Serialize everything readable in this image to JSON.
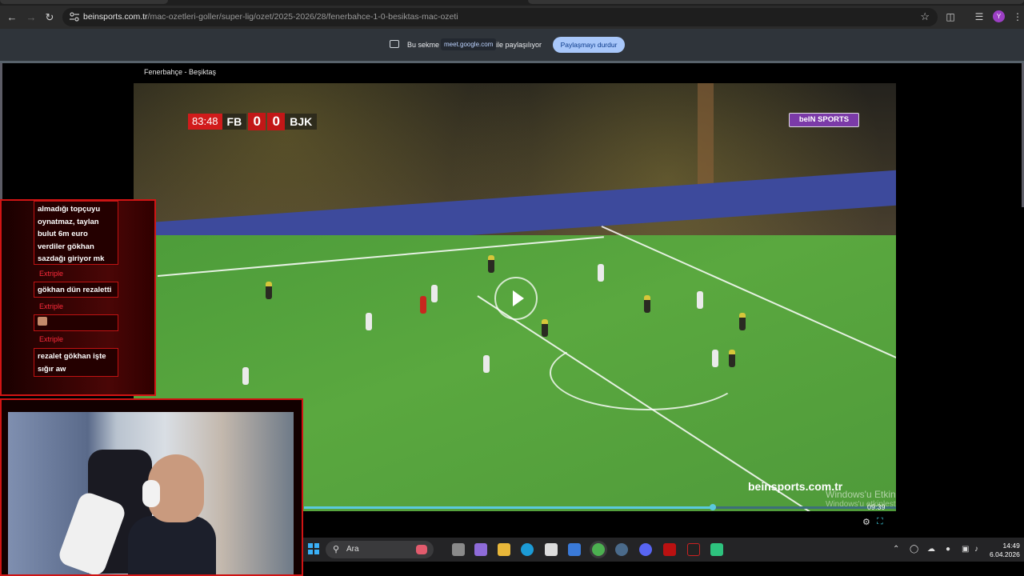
{
  "browser": {
    "url_domain": "beinsports.com.tr",
    "url_path": "/mac-ozetleri-goller/super-lig/ozet/2025-2026/28/fenerbahce-1-0-besiktas-mac-ozeti",
    "profile_initial": "Y"
  },
  "share_bar": {
    "text_before": "Bu sekme",
    "host": "meet.google.com",
    "text_after": "ile paylaşılıyor",
    "stop_button": "Paylaşmayı durdur"
  },
  "video": {
    "title": "Fenerbahçe - Beşiktaş",
    "scorebug": {
      "clock": "83:48",
      "home_team": "FB",
      "home_score": "0",
      "away_score": "0",
      "away_team": "BJK"
    },
    "broadcaster_logo": "beIN SPORTS",
    "watermark": "beinsports.com.tr",
    "current_time": "09:39",
    "progress_percent": 69
  },
  "windows_activation": {
    "title": "Windows'u Etkinleştir",
    "subtitle": "Windows'u etkinleştirmek için Ayarlar'a gidin."
  },
  "chat": {
    "messages": [
      {
        "text": "almadığı topçuyu oynatmaz, taylan bulut 6m euro verdiler gökhan sazdağı giriyor mk"
      },
      {
        "author": "Extriple",
        "text": "gökhan dün rezaletti"
      },
      {
        "author": "Extriple",
        "text": ""
      },
      {
        "author": "Extriple",
        "text": "rezalet gökhan işte sığır aw"
      }
    ]
  },
  "taskbar": {
    "search_placeholder": "Ara",
    "time": "14:49",
    "date": "6.04.2026"
  },
  "colors": {
    "accent_red": "#d01414",
    "share_button": "#a8c7fa",
    "progress": "#5bc9de"
  }
}
